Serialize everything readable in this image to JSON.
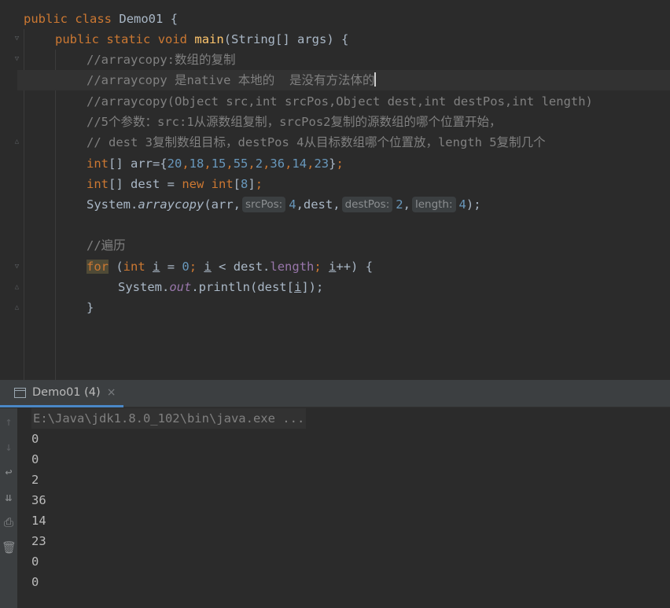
{
  "code": {
    "class_decl": {
      "kw1": "public",
      "kw2": "class",
      "name": "Demo01",
      "brace": "{"
    },
    "method_decl": {
      "kw1": "public",
      "kw2": "static",
      "kw3": "void",
      "name": "main",
      "params": "(String[] args) {"
    },
    "comment1": "//arraycopy:数组的复制",
    "comment2": "//arraycopy 是native 本地的  是没有方法体的",
    "comment3": "//arraycopy(Object src,int srcPos,Object dest,int destPos,int length)",
    "comment4": "//5个参数：src:1从源数组复制，srcPos2复制的源数组的哪个位置开始，",
    "comment5": "// dest 3复制数组目标，destPos 4从目标数组哪个位置放，length 5复制几个",
    "arr_line": {
      "kw": "int",
      "decl": "[] arr={",
      "values": [
        "20",
        "18",
        "15",
        "55",
        "2",
        "36",
        "14",
        "23"
      ],
      "close": "}",
      "semi": ";"
    },
    "dest_line": {
      "kw": "int",
      "decl": "[] dest = ",
      "new_kw": "new",
      "type_kw": "int",
      "open": "[",
      "size": "8",
      "close": "]",
      "semi": ";"
    },
    "copy_line": {
      "prefix": "System.",
      "method": "arraycopy",
      "arg1": "(arr,",
      "hint1": "srcPos:",
      "val1": "4",
      "arg2": ",dest,",
      "hint2": "destPos:",
      "val2": "2",
      "comma": ",",
      "hint3": "length:",
      "val3": "4",
      "close": ");"
    },
    "comment6": "//遍历",
    "for_line": {
      "kw": "for",
      "p1": " (",
      "int_kw": "int",
      "sp": " ",
      "var": "i",
      "eq": " = ",
      "zero": "0",
      "semi1": "; ",
      "var2": "i",
      "lt": " < dest.",
      "field": "length",
      "semi2": "; ",
      "var3": "i",
      "inc": "++) {"
    },
    "print_line": {
      "prefix": "System.",
      "field": "out",
      "method": ".println(dest[",
      "var": "i",
      "close": "]);"
    },
    "close_brace": "}"
  },
  "run_panel": {
    "tab_label": "Demo01 (4)",
    "tab_close": "×",
    "command": "E:\\Java\\jdk1.8.0_102\\bin\\java.exe ...",
    "output": [
      "0",
      "0",
      "2",
      "36",
      "14",
      "23",
      "0",
      "0"
    ]
  },
  "icons": {
    "toolbar": [
      "arrow-up-icon",
      "arrow-down-icon",
      "soft-wrap-icon",
      "scroll-to-end-icon",
      "print-icon",
      "trash-icon"
    ]
  },
  "colors": {
    "background": "#2b2b2b",
    "keyword": "#cc7832",
    "function": "#ffc66d",
    "number": "#6897bb",
    "comment": "#808080",
    "field": "#9876aa",
    "text": "#a9b7c6"
  }
}
